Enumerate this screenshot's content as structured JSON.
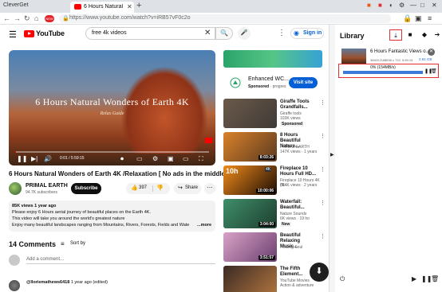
{
  "browser": {
    "app_name": "CleverGet",
    "badge": "NEW",
    "tab_title": "6 Hours Natural Wond",
    "url": "https://www.youtube.com/watch?v=iRB57vF0c2o"
  },
  "youtube": {
    "logo_text": "YouTube",
    "search_query": "free 4k videos",
    "signin_label": "Sign in"
  },
  "player": {
    "overlay_title": "6 Hours Natural Wonders of Earth 4K",
    "overlay_signature": "Relax Guide",
    "time": "0:01 / 5:59:15",
    "progress": 0.003
  },
  "video": {
    "title": "6 Hours Natural Wonders of Earth 4K /Relaxation [ No ads in the middle]",
    "channel": "PRIMAL EARTH",
    "subscribers": "94.7K subscribers",
    "subscribe_label": "Subscribe",
    "likes": "397",
    "share_label": "Share",
    "desc_meta": "85K views  1 year ago",
    "desc_lines": [
      "Please enjoy 6 Hours aerial journey of beautiful places on the Earth 4K.",
      "This video will take you around the world's greatest nature",
      "Enjoy many beautiful landscapes ranging from Mountains, Rivers, Forests, Fields and Wate"
    ],
    "desc_more": "...more"
  },
  "comments": {
    "count_label": "14 Comments",
    "sort_label": "Sort by",
    "add_placeholder": "Add a comment...",
    "first_author": "@lloriemathews6418",
    "first_time": "1 year ago (edited)"
  },
  "ad": {
    "title": "Enhanced WC...",
    "sponsored": "Sponsored",
    "advertiser": "· progres",
    "button": "Visit site"
  },
  "recommendations": [
    {
      "title": "Giraffe Tools Grandfalls...",
      "meta1": "Giraffe tools",
      "meta2": "103K views",
      "badge": "Sponsored",
      "duration": "",
      "overlay": "",
      "colors": [
        "#6b5a4a",
        "#3f3a36"
      ]
    },
    {
      "title": "8 Hours Beautiful Nature...",
      "meta1": "PRIMAL EARTH",
      "meta2": "147K views · 1 years",
      "badge": "",
      "duration": "8:03:26",
      "overlay": "",
      "colors": [
        "#d9822b",
        "#5b3a1e"
      ]
    },
    {
      "title": "Fireplace 10 Hours Full HD...",
      "meta1": "Fireplace 10 Hours 4K (N...",
      "meta2": "884K views · 2 years",
      "badge": "",
      "duration": "10:00:06",
      "overlay": "10h",
      "tag": "4K",
      "colors": [
        "#f08a1a",
        "#1c0c04"
      ]
    },
    {
      "title": "Waterfall: Beautiful...",
      "meta1": "Nature Sounds",
      "meta2": "6K views · 19 ho",
      "badge": "New",
      "duration": "3:04:00",
      "overlay": "",
      "colors": [
        "#3f8f6a",
        "#1d3d2e"
      ]
    },
    {
      "title": "Beautiful Relaxing Music...",
      "meta1": "Healing Soul",
      "meta2": "",
      "badge": "",
      "duration": "3:51:57",
      "overlay": "",
      "colors": [
        "#d9a3c7",
        "#6b3e70"
      ]
    },
    {
      "title": "The Fifth Element...",
      "meta1": "YouTube Movies",
      "meta2": "Action & adventure",
      "badge": "",
      "duration": "",
      "overlay": "",
      "colors": [
        "#3a2a24",
        "#b0753e"
      ]
    }
  ],
  "library": {
    "title": "Library",
    "item_title": "6 Hours Fantastic Views o...",
    "item_res": "3840X2160",
    "item_fps": "1338 x 720",
    "item_time": "5:59:15",
    "item_size": "2.81 GB",
    "percent_text": "0% (154MB/s)",
    "progress": 0.0
  }
}
